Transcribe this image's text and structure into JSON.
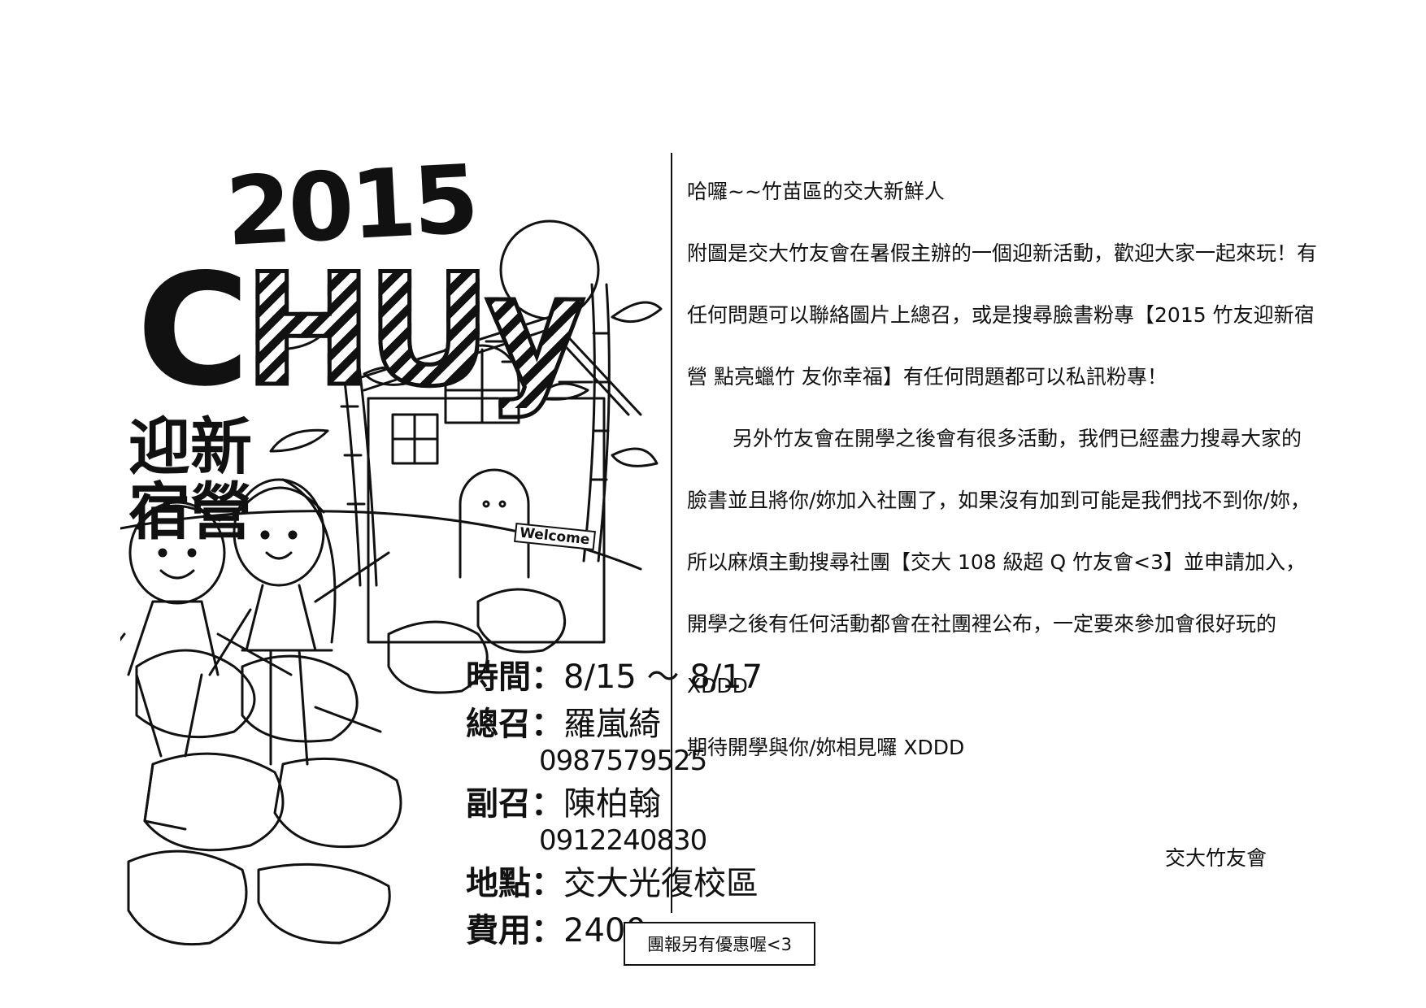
{
  "poster": {
    "year": "2015",
    "logo_letters": [
      "C",
      "H",
      "U",
      "y"
    ],
    "camp_title_line1": "迎新",
    "camp_title_line2": "宿營",
    "welcome_sign": "Welcome",
    "info": {
      "time_label": "時間：",
      "time_value": "8/15 ～ 8/17",
      "leader_label": "總召：",
      "leader_value": "羅嵐綺",
      "leader_phone": "0987579525",
      "vice_label": "副召：",
      "vice_value": "陳柏翰",
      "vice_phone": "0912240830",
      "place_label": "地點：",
      "place_value": "交大光復校區",
      "fee_label": "費用：",
      "fee_value": "2400"
    }
  },
  "letter": {
    "greeting": "哈囉~~竹苗區的交大新鮮人",
    "paragraph1": "附圖是交大竹友會在暑假主辦的一個迎新活動，歡迎大家一起來玩！有任何問題可以聯絡圖片上總召，或是搜尋臉書粉專【2015 竹友迎新宿營 點亮蠟竹 友你幸福】有任何問題都可以私訊粉專！",
    "paragraph2": "另外竹友會在開學之後會有很多活動，我們已經盡力搜尋大家的臉書並且將你/妳加入社團了，如果沒有加到可能是我們找不到你/妳，所以麻煩主動搜尋社團【交大 108 級超 Q 竹友會<3】並申請加入，開學之後有任何活動都會在社團裡公布，一定要來參加會很好玩的 XDDD",
    "closing": "期待開學與你/妳相見囉 XDDD",
    "signature": "交大竹友會"
  },
  "note": "團報另有優惠喔<3"
}
